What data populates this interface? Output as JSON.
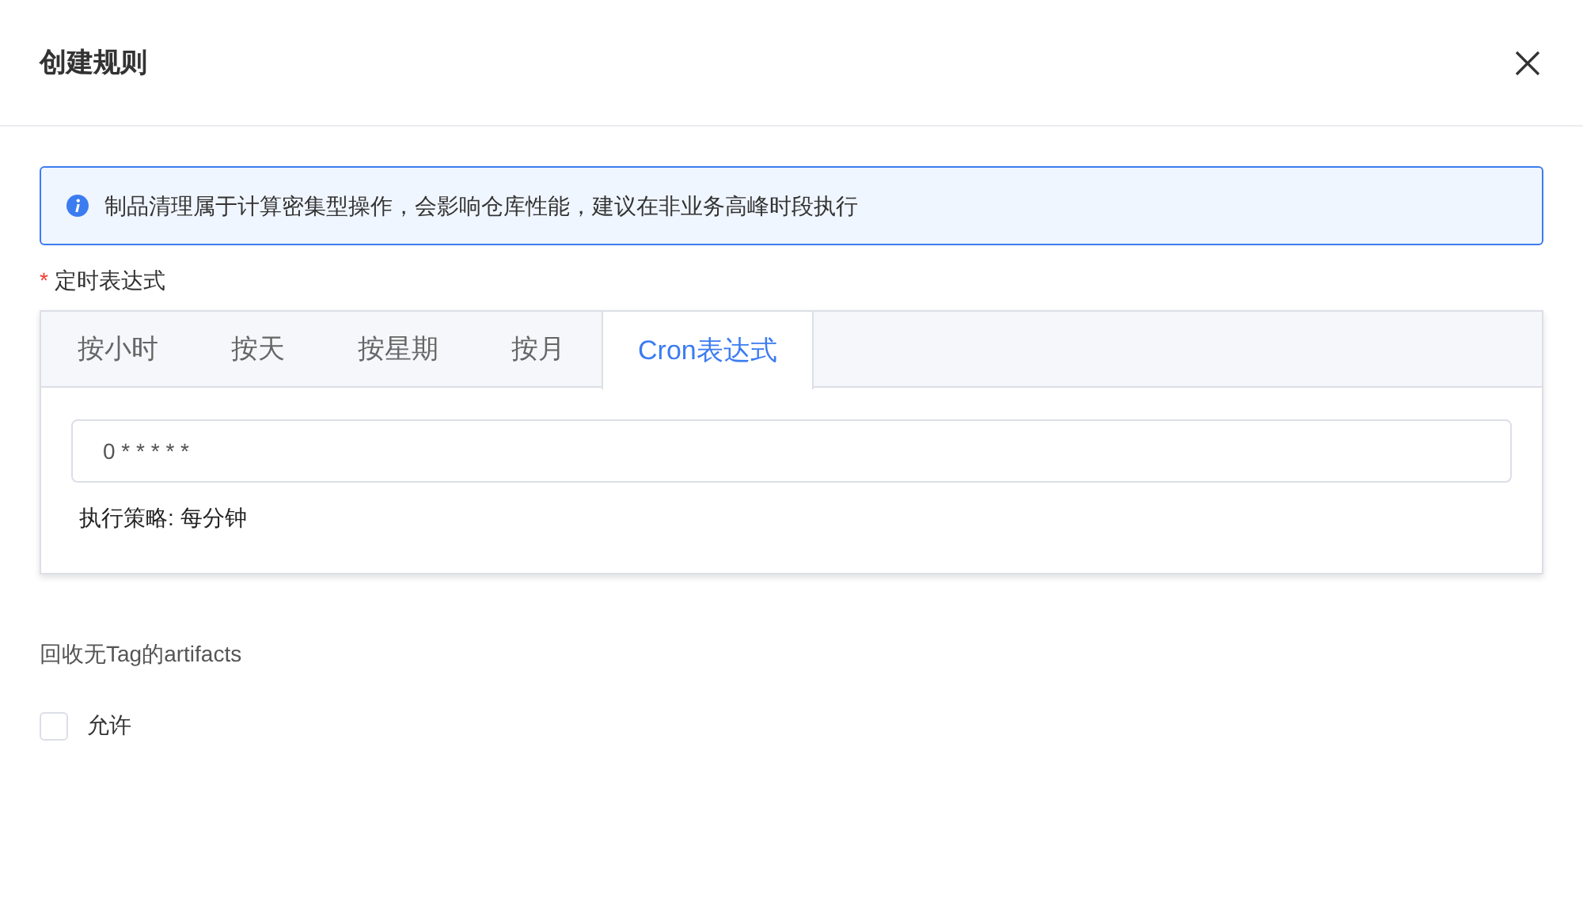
{
  "dialog": {
    "title": "创建规则"
  },
  "alert": {
    "text": "制品清理属于计算密集型操作，会影响仓库性能，建议在非业务高峰时段执行"
  },
  "schedule": {
    "label": "定时表达式",
    "required_mark": "*",
    "tabs": [
      {
        "label": "按小时",
        "selected": false
      },
      {
        "label": "按天",
        "selected": false
      },
      {
        "label": "按星期",
        "selected": false
      },
      {
        "label": "按月",
        "selected": false
      },
      {
        "label": "Cron表达式",
        "selected": true
      }
    ],
    "cron_value": "0 * * * * *",
    "strategy": "执行策略: 每分钟"
  },
  "untagged": {
    "label": "回收无Tag的artifacts",
    "checkbox": {
      "label": "允许",
      "checked": false
    }
  }
}
